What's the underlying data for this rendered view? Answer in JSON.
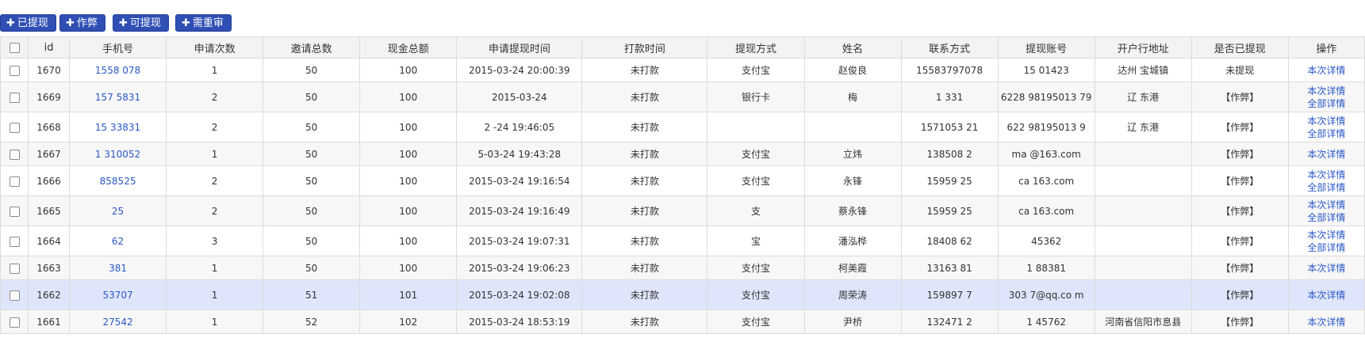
{
  "toolbar": {
    "buttons": [
      {
        "label": "已提现"
      },
      {
        "label": "作弊"
      },
      {
        "label": "可提现"
      },
      {
        "label": "需重审"
      }
    ]
  },
  "table": {
    "headers": [
      "",
      "id",
      "手机号",
      "申请次数",
      "邀请总数",
      "现金总额",
      "申请提现时间",
      "打款时间",
      "提现方式",
      "姓名",
      "联系方式",
      "提现账号",
      "开户行地址",
      "是否已提现",
      "操作"
    ],
    "rows": [
      {
        "id": "1670",
        "phone": "1558   078",
        "apply": "1",
        "invite": "50",
        "cash": "100",
        "time": "2015-03-24 20:00:39",
        "pay": "未打款",
        "method": "支付宝",
        "name": "赵俊良",
        "contact": "15583797078",
        "account": "15   01423",
        "bank": "达州   宝城镇",
        "status": "未提现",
        "actions": [
          "本次详情"
        ]
      },
      {
        "id": "1669",
        "phone": "157   5831",
        "apply": "2",
        "invite": "50",
        "cash": "100",
        "time": "2015-03-24",
        "pay": "未打款",
        "method": "银行卡",
        "name": "  梅",
        "contact": "1   331",
        "account": "6228   98195013 79",
        "bank": "辽   东港",
        "status": "【作弊】",
        "actions": [
          "本次详情",
          "全部详情"
        ]
      },
      {
        "id": "1668",
        "phone": "15   33831",
        "apply": "2",
        "invite": "50",
        "cash": "100",
        "time": "2   -24 19:46:05",
        "pay": "未打款",
        "method": "",
        "name": "",
        "contact": "1571053   21",
        "account": "622   98195013 9",
        "bank": "辽   东港",
        "status": "【作弊】",
        "actions": [
          "本次详情",
          "全部详情"
        ]
      },
      {
        "id": "1667",
        "phone": "1   310052",
        "apply": "1",
        "invite": "50",
        "cash": "100",
        "time": "  5-03-24 19:43:28",
        "pay": "未打款",
        "method": "支付宝",
        "name": "立炜",
        "contact": "138508   2",
        "account": "ma   @163.com",
        "bank": "",
        "status": "【作弊】",
        "actions": [
          "本次详情"
        ]
      },
      {
        "id": "1666",
        "phone": "  858525",
        "apply": "2",
        "invite": "50",
        "cash": "100",
        "time": "2015-03-24 19:16:54",
        "pay": "未打款",
        "method": "支付宝",
        "name": "永锋",
        "contact": "15959   25",
        "account": "ca   163.com",
        "bank": "",
        "status": "【作弊】",
        "actions": [
          "本次详情",
          "全部详情"
        ]
      },
      {
        "id": "1665",
        "phone": "  25",
        "apply": "2",
        "invite": "50",
        "cash": "100",
        "time": "2015-03-24 19:16:49",
        "pay": "未打款",
        "method": "支",
        "name": "蔡永锋",
        "contact": "15959   25",
        "account": "ca   163.com",
        "bank": "",
        "status": "【作弊】",
        "actions": [
          "本次详情",
          "全部详情"
        ]
      },
      {
        "id": "1664",
        "phone": "  62",
        "apply": "3",
        "invite": "50",
        "cash": "100",
        "time": "2015-03-24 19:07:31",
        "pay": "未打款",
        "method": "宝",
        "name": "潘泓桦",
        "contact": "18408   62",
        "account": "  45362",
        "bank": "",
        "status": "【作弊】",
        "actions": [
          "本次详情",
          "全部详情"
        ]
      },
      {
        "id": "1663",
        "phone": "  381",
        "apply": "1",
        "invite": "50",
        "cash": "100",
        "time": "2015-03-24 19:06:23",
        "pay": "未打款",
        "method": "支付宝",
        "name": "柯美霞",
        "contact": "13163   81",
        "account": "1   88381",
        "bank": "",
        "status": "【作弊】",
        "actions": [
          "本次详情"
        ]
      },
      {
        "id": "1662",
        "phone": "  53707",
        "apply": "1",
        "invite": "51",
        "cash": "101",
        "time": "2015-03-24 19:02:08",
        "pay": "未打款",
        "method": "支付宝",
        "name": "周荣涛",
        "contact": "159897   7",
        "account": "303   7@qq.co m",
        "bank": "",
        "status": "【作弊】",
        "actions": [
          "本次详情"
        ]
      },
      {
        "id": "1661",
        "phone": "  27542",
        "apply": "1",
        "invite": "52",
        "cash": "102",
        "time": "2015-03-24 18:53:19",
        "pay": "未打款",
        "method": "支付宝",
        "name": "尹桥",
        "contact": "132471   2",
        "account": "1   45762",
        "bank": "河南省信阳市息县",
        "status": "【作弊】",
        "actions": [
          "本次详情"
        ]
      }
    ]
  }
}
